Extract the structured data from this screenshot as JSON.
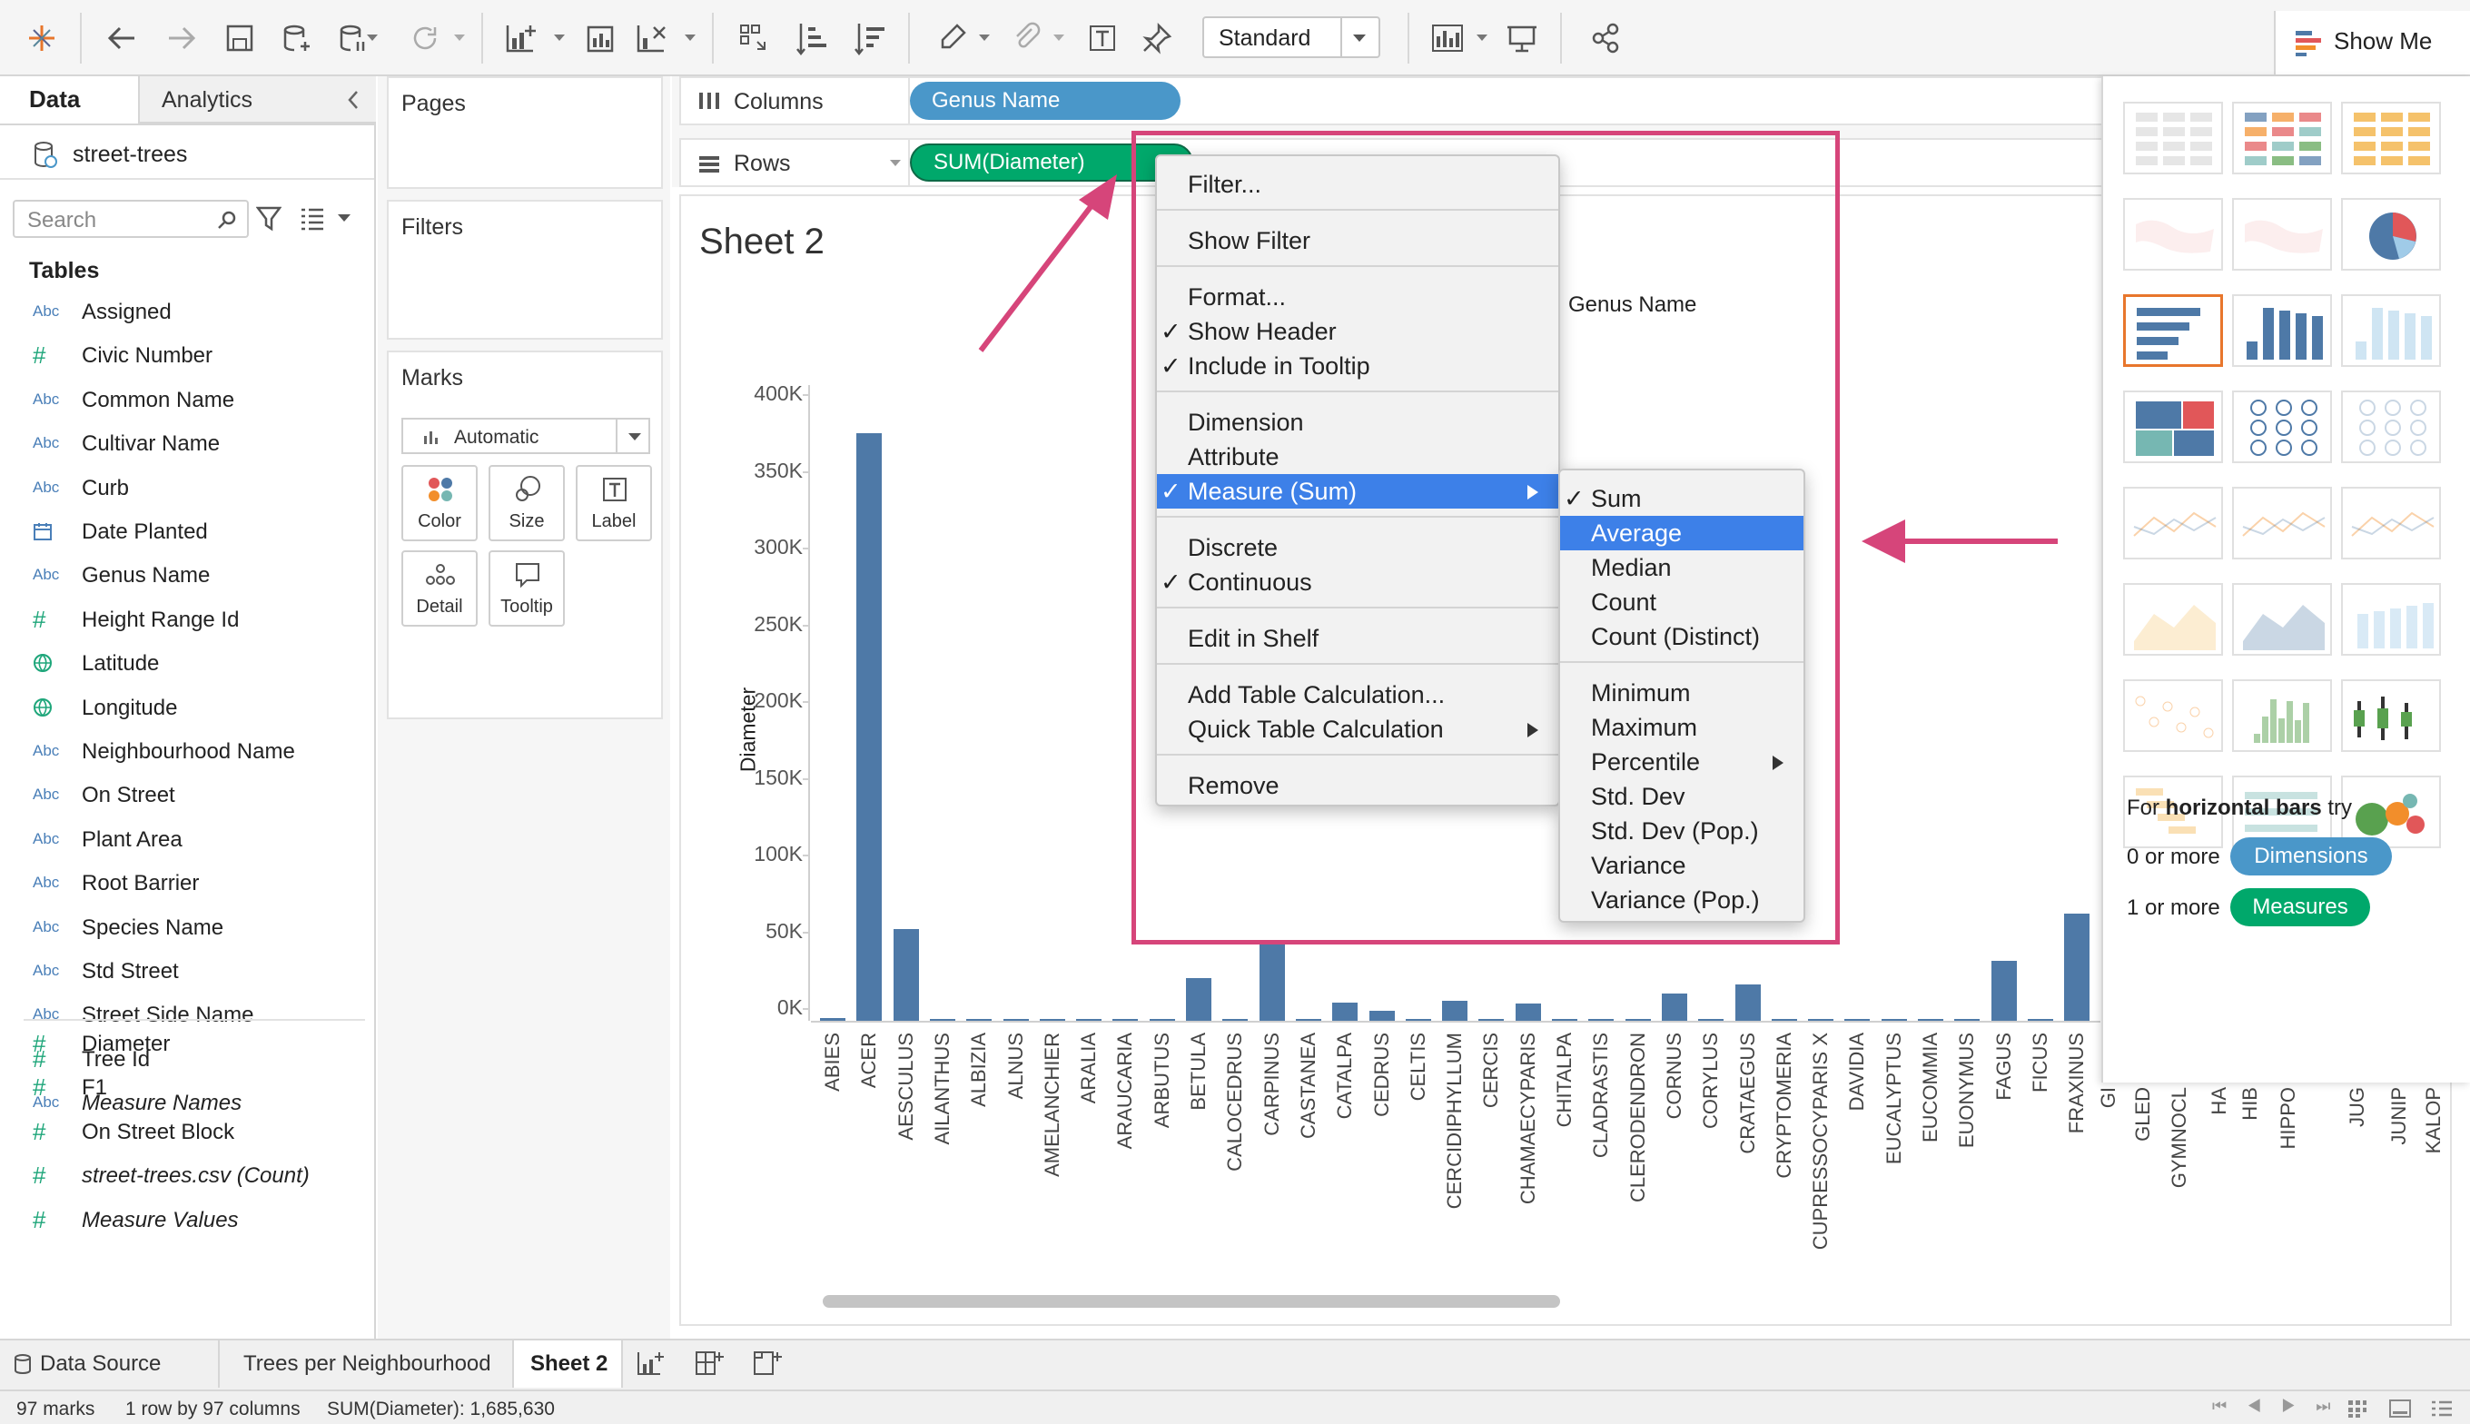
{
  "toolbar": {
    "fit_select": "Standard",
    "show_me": "Show Me"
  },
  "data_pane": {
    "tab_data": "Data",
    "tab_analytics": "Analytics",
    "datasource": "street-trees",
    "search_placeholder": "Search",
    "tables_label": "Tables",
    "fields": [
      {
        "icon": "Abc",
        "name": "Assigned"
      },
      {
        "icon": "#",
        "name": "Civic Number"
      },
      {
        "icon": "Abc",
        "name": "Common Name"
      },
      {
        "icon": "Abc",
        "name": "Cultivar Name"
      },
      {
        "icon": "Abc",
        "name": "Curb"
      },
      {
        "icon": "date",
        "name": "Date Planted"
      },
      {
        "icon": "Abc",
        "name": "Genus Name"
      },
      {
        "icon": "#",
        "name": "Height Range Id"
      },
      {
        "icon": "globe",
        "name": "Latitude"
      },
      {
        "icon": "globe",
        "name": "Longitude"
      },
      {
        "icon": "Abc",
        "name": "Neighbourhood Name"
      },
      {
        "icon": "Abc",
        "name": "On Street"
      },
      {
        "icon": "Abc",
        "name": "Plant Area"
      },
      {
        "icon": "Abc",
        "name": "Root Barrier"
      },
      {
        "icon": "Abc",
        "name": "Species Name"
      },
      {
        "icon": "Abc",
        "name": "Std Street"
      },
      {
        "icon": "Abc",
        "name": "Street Side Name"
      },
      {
        "icon": "#",
        "name": "Tree Id"
      },
      {
        "icon": "Abc",
        "name": "Measure Names"
      }
    ],
    "measures": [
      {
        "icon": "#",
        "name": "Diameter"
      },
      {
        "icon": "#",
        "name": "F1"
      },
      {
        "icon": "#",
        "name": "On Street Block"
      },
      {
        "icon": "#",
        "name": "street-trees.csv (Count)"
      },
      {
        "icon": "#",
        "name": "Measure Values"
      }
    ]
  },
  "cards": {
    "pages": "Pages",
    "filters": "Filters",
    "marks": "Marks",
    "mark_type": "Automatic",
    "mark_buttons": [
      "Color",
      "Size",
      "Label",
      "Detail",
      "Tooltip"
    ]
  },
  "shelves": {
    "columns_label": "Columns",
    "rows_label": "Rows",
    "columns_pill": "Genus Name",
    "rows_pill": "SUM(Diameter)"
  },
  "sheet": {
    "title": "Sheet 2",
    "column_header": "Genus Name"
  },
  "chart_data": {
    "type": "bar",
    "title": "Sheet 2",
    "xlabel": "Genus Name",
    "ylabel": "Diameter",
    "ylim": [
      0,
      400000
    ],
    "yticks": [
      "400K",
      "350K",
      "300K",
      "250K",
      "200K",
      "150K",
      "100K",
      "50K",
      "0K"
    ],
    "categories": [
      "ABIES",
      "ACER",
      "AESCULUS",
      "AILANTHUS",
      "ALBIZIA",
      "ALNUS",
      "AMELANCHIER",
      "ARALIA",
      "ARAUCARIA",
      "ARBUTUS",
      "BETULA",
      "CALOCEDRUS",
      "CARPINUS",
      "CASTANEA",
      "CATALPA",
      "CEDRUS",
      "CELTIS",
      "CERCIDIPHYLLUM",
      "CERCIS",
      "CHAMAECYPARIS",
      "CHITALPA",
      "CLADRASTIS",
      "CLERODENDRON",
      "CORNUS",
      "CORYLUS",
      "CRATAEGUS",
      "CRYPTOMERIA",
      "CUPRESSOCYPARIS X",
      "DAVIDIA",
      "EUCALYPTUS",
      "EUCOMMIA",
      "EUONYMUS",
      "FAGUS",
      "FICUS",
      "FRAXINUS"
    ],
    "values": [
      1500,
      383000,
      60000,
      300,
      200,
      1000,
      800,
      200,
      200,
      600,
      28000,
      300,
      50000,
      1200,
      12000,
      6500,
      900,
      13000,
      600,
      11500,
      300,
      300,
      200,
      18000,
      1200,
      23500,
      300,
      500,
      1200,
      300,
      300,
      300,
      39000,
      300,
      70000
    ],
    "cut_off_labels": [
      "GI",
      "GLED",
      "GYMNOCL",
      "HA",
      "HIB",
      "HIPPO",
      "JUG",
      "JUNIP",
      "KALOP"
    ]
  },
  "context_menu": {
    "items": [
      "Filter...",
      "Show Filter",
      "Format...",
      "Show Header",
      "Include in Tooltip",
      "Dimension",
      "Attribute",
      "Measure (Sum)",
      "Discrete",
      "Continuous",
      "Edit in Shelf",
      "Add Table Calculation...",
      "Quick Table Calculation",
      "Remove"
    ]
  },
  "submenu": {
    "items": [
      "Sum",
      "Average",
      "Median",
      "Count",
      "Count (Distinct)",
      "Minimum",
      "Maximum",
      "Percentile",
      "Std. Dev",
      "Std. Dev (Pop.)",
      "Variance",
      "Variance (Pop.)"
    ]
  },
  "show_me": {
    "hint_prefix": "For ",
    "hint_bold": "horizontal bars",
    "hint_suffix": " try",
    "dim_prefix": "0 or more",
    "dim_label": "Dimensions",
    "meas_prefix": "1 or more",
    "meas_label": "Measures"
  },
  "tabs": {
    "data_source": "Data Source",
    "sheet1": "Trees per Neighbourhood",
    "sheet2": "Sheet 2"
  },
  "status": {
    "marks": "97 marks",
    "dims": "1 row by 97 columns",
    "sum": "SUM(Diameter): 1,685,630"
  },
  "colors": {
    "bar": "#4e79a7",
    "pill_dim": "#4a97c9",
    "pill_meas": "#00a86b",
    "annotation": "#d6457a",
    "menu_highlight": "#3d80e8"
  }
}
